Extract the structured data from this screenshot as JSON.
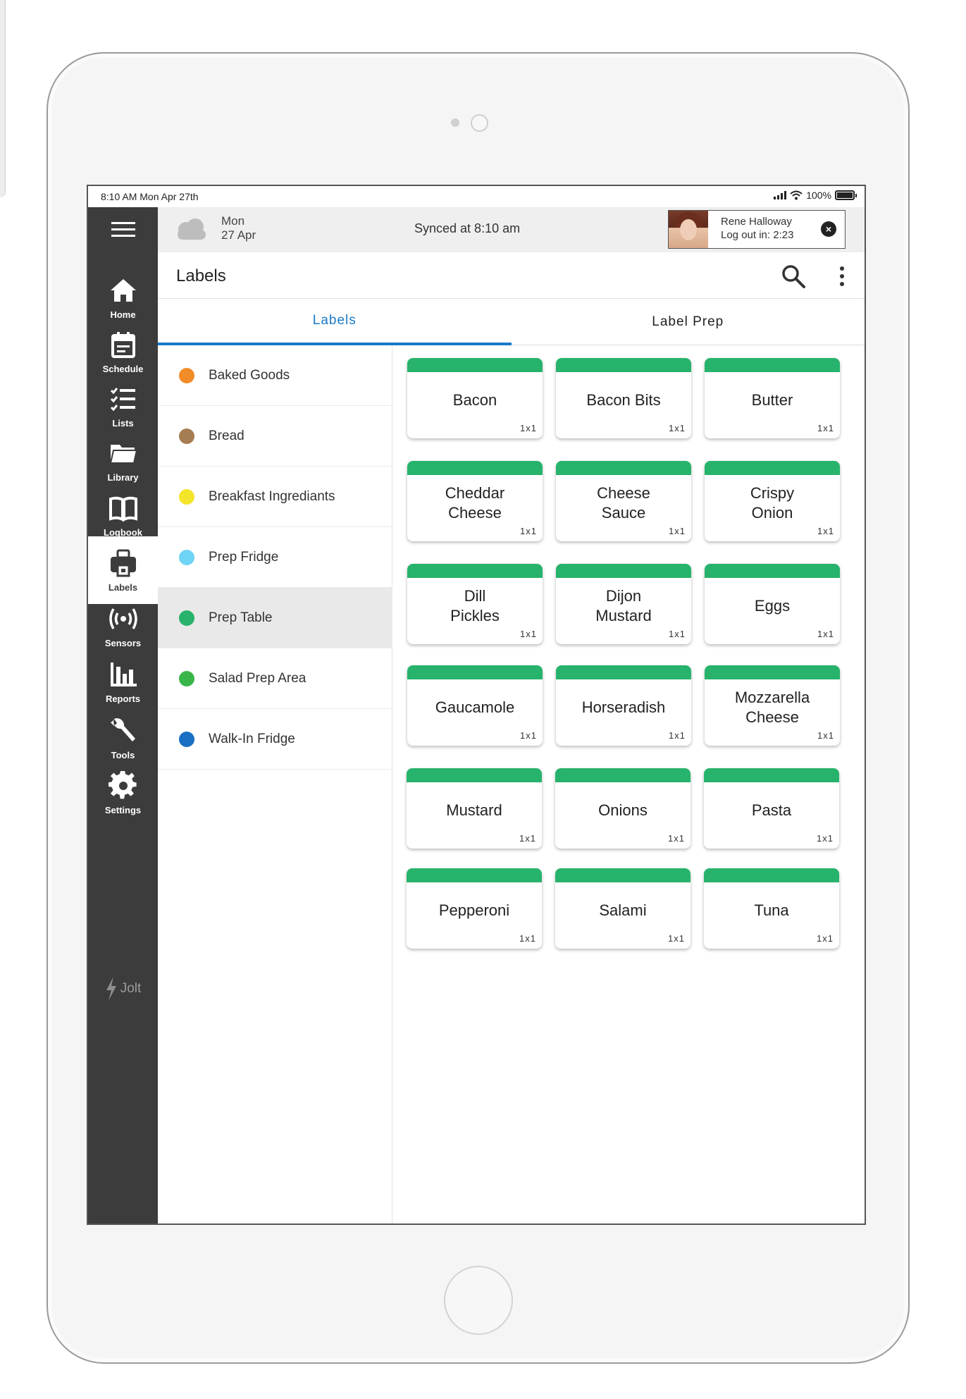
{
  "status_bar": {
    "time": "8:10 AM Mon Apr 27th",
    "battery": "100%",
    "battery_level": 1.0
  },
  "sidebar": {
    "items": [
      {
        "label": "Home",
        "icon": "home-icon"
      },
      {
        "label": "Schedule",
        "icon": "calendar-icon"
      },
      {
        "label": "Lists",
        "icon": "checklist-icon"
      },
      {
        "label": "Library",
        "icon": "folder-icon"
      },
      {
        "label": "Logbook",
        "icon": "book-icon"
      },
      {
        "label": "Labels",
        "icon": "label-printer-icon"
      },
      {
        "label": "Sensors",
        "icon": "broadcast-icon"
      },
      {
        "label": "Reports",
        "icon": "bar-chart-icon"
      },
      {
        "label": "Tools",
        "icon": "wrench-icon"
      },
      {
        "label": "Settings",
        "icon": "gear-icon"
      }
    ],
    "active": "Labels",
    "brand": "Jolt"
  },
  "header": {
    "weather_icon": "cloud-icon",
    "day": "Mon",
    "date": "27 Apr",
    "synced": "Synced at 8:10 am",
    "user": {
      "name": "Rene Halloway",
      "logout": "Log out in: 2:23"
    }
  },
  "page": {
    "title": "Labels"
  },
  "tabs": [
    {
      "label": "Labels",
      "active": true
    },
    {
      "label": "Label Prep",
      "active": false
    }
  ],
  "categories": [
    {
      "name": "Baked Goods",
      "color": "#f28c28"
    },
    {
      "name": "Bread",
      "color": "#a67c52"
    },
    {
      "name": "Breakfast Ingrediants",
      "color": "#f5e52a"
    },
    {
      "name": "Prep Fridge",
      "color": "#6fd3f5"
    },
    {
      "name": "Prep Table",
      "color": "#27b36b",
      "active": true
    },
    {
      "name": "Salad Prep Area",
      "color": "#3ab54a"
    },
    {
      "name": "Walk-In Fridge",
      "color": "#1a6fc4"
    }
  ],
  "labels": [
    {
      "name": "Bacon",
      "size": "1x1"
    },
    {
      "name": "Bacon Bits",
      "size": "1x1"
    },
    {
      "name": "Butter",
      "size": "1x1"
    },
    {
      "name": "Cheddar\nCheese",
      "size": "1x1"
    },
    {
      "name": "Cheese\nSauce",
      "size": "1x1"
    },
    {
      "name": "Crispy\nOnion",
      "size": "1x1"
    },
    {
      "name": "Dill\nPickles",
      "size": "1x1"
    },
    {
      "name": "Dijon\nMustard",
      "size": "1x1"
    },
    {
      "name": "Eggs",
      "size": "1x1"
    },
    {
      "name": "Gaucamole",
      "size": "1x1"
    },
    {
      "name": "Horseradish",
      "size": "1x1"
    },
    {
      "name": "Mozzarella\nCheese",
      "size": "1x1"
    },
    {
      "name": "Mustard",
      "size": "1x1"
    },
    {
      "name": "Onions",
      "size": "1x1"
    },
    {
      "name": "Pasta",
      "size": "1x1"
    },
    {
      "name": "Pepperoni",
      "size": "1x1"
    },
    {
      "name": "Salami",
      "size": "1x1"
    },
    {
      "name": "Tuna",
      "size": "1x1"
    }
  ],
  "colors": {
    "accent": "#1a7ac7",
    "label_bar": "#27b36b",
    "sidebar": "#3c3c3c"
  }
}
